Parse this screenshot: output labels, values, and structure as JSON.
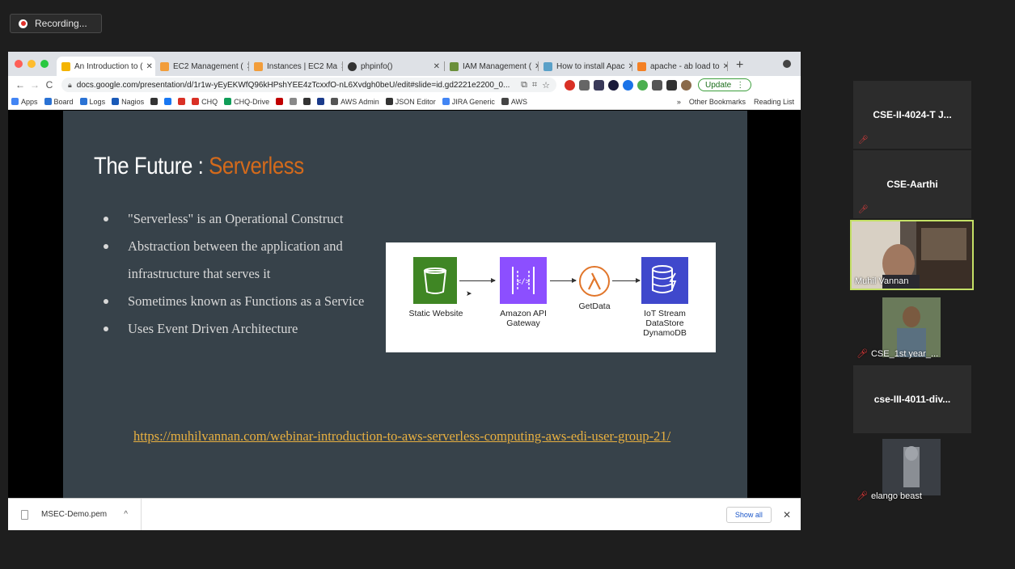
{
  "recording": {
    "label": "Recording..."
  },
  "browser": {
    "tabs": [
      {
        "label": "An Introduction to (",
        "fav_color": "#f4b400",
        "active": true
      },
      {
        "label": "EC2 Management (",
        "fav_color": "#f29d3a"
      },
      {
        "label": "Instances | EC2 Ma",
        "fav_color": "#f29d3a"
      },
      {
        "label": "phpinfo()",
        "fav_color": "#333333"
      },
      {
        "label": "IAM Management (",
        "fav_color": "#6a8f3a"
      },
      {
        "label": "How to install Apac",
        "fav_color": "#5aa0c8"
      },
      {
        "label": "apache - ab load to",
        "fav_color": "#f48024"
      }
    ],
    "address": {
      "url": "docs.google.com/presentation/d/1r1w-yEyEKWfQ96kHPshYEE4zTcxxfO-nL6Xvdgh0beU/edit#slide=id.gd2221e2200_0..."
    },
    "update_label": "Update",
    "bookmarks": [
      {
        "label": "Apps",
        "color": "#4285f4"
      },
      {
        "label": "Board",
        "color": "#2a72d4"
      },
      {
        "label": "Logs",
        "color": "#2a72d4"
      },
      {
        "label": "Nagios",
        "color": "#1a5ab8"
      },
      {
        "label": "",
        "color": "#333333"
      },
      {
        "label": "",
        "color": "#1877f2"
      },
      {
        "label": "",
        "color": "#d93025"
      },
      {
        "label": "CHQ",
        "color": "#d93025"
      },
      {
        "label": "CHQ-Drive",
        "color": "#0f9d58"
      },
      {
        "label": "",
        "color": "#c00000"
      },
      {
        "label": "",
        "color": "#888888"
      },
      {
        "label": "",
        "color": "#333333"
      },
      {
        "label": "",
        "color": "#1a3a8a"
      },
      {
        "label": "AWS Admin",
        "color": "#555555"
      },
      {
        "label": "JSON Editor",
        "color": "#333333"
      },
      {
        "label": "JIRA Generic",
        "color": "#4285f4"
      },
      {
        "label": "AWS",
        "color": "#444444"
      }
    ],
    "bookmarks_right": [
      {
        "label": "»"
      },
      {
        "label": "Other Bookmarks"
      },
      {
        "label": "Reading List"
      }
    ],
    "downloads": {
      "file": "MSEC-Demo.pem",
      "show_all": "Show all"
    }
  },
  "slide": {
    "title_prefix": "The Future : ",
    "title_accent": "Serverless",
    "bullets": [
      "\"Serverless\" is an Operational Construct",
      "Abstraction between the application and infrastructure that serves it",
      "Sometimes known as Functions as a Service",
      "Uses Event Driven Architecture"
    ],
    "link": "https://muhilvannan.com/webinar-introduction-to-aws-serverless-computing-aws-edi-user-group-21/",
    "diagram": {
      "nodes": [
        {
          "label": "Static Website"
        },
        {
          "label": "Amazon API Gateway"
        },
        {
          "label": "GetData"
        },
        {
          "label": "IoT Stream DataStore DynamoDB"
        }
      ]
    }
  },
  "participants": [
    {
      "name": "CSE-II-4024-T J...",
      "type": "name"
    },
    {
      "name": "CSE-Aarthi",
      "type": "name"
    },
    {
      "name": "Muhil Vannan",
      "type": "video"
    },
    {
      "name": "CSE_1st year_...",
      "type": "video"
    },
    {
      "name": "cse-III-4011-div...",
      "type": "name"
    },
    {
      "name": "elango beast",
      "type": "video"
    }
  ]
}
